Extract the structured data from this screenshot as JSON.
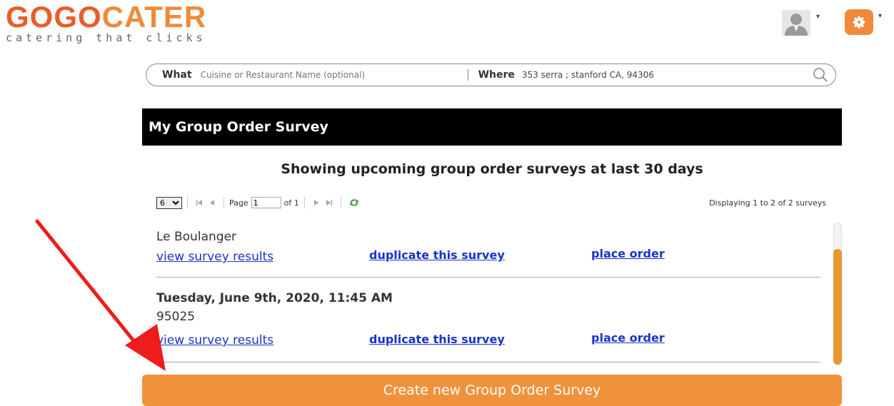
{
  "logo": {
    "part1": "GOGO",
    "part2": "CATER",
    "tagline": "catering that clicks"
  },
  "header": {
    "user_icon": "user-avatar-icon",
    "settings_icon": "gear-icon",
    "accent": "#f08a3a"
  },
  "search": {
    "what_label": "What",
    "what_placeholder": "Cuisine or Restaurant Name (optional)",
    "where_label": "Where",
    "where_value": "353 serra ; stanford CA, 94306"
  },
  "panel": {
    "title": "My Group Order Survey",
    "subtitle": "Showing upcoming group order surveys at last 30 days"
  },
  "pager": {
    "page_size": "6",
    "page_label": "Page",
    "page_value": "1",
    "of_label": "of 1",
    "displaying": "Displaying 1 to 2 of 2 surveys"
  },
  "surveys": [
    {
      "lines": [
        "Le Boulanger"
      ],
      "view_link": "view survey results",
      "duplicate_link": "duplicate this survey",
      "order_link": "place order"
    },
    {
      "date": "Tuesday, June 9th, 2020, 11:45 AM",
      "lines": [
        "95025"
      ],
      "view_link": "view survey results",
      "duplicate_link": "duplicate this survey",
      "order_link": "place order"
    }
  ],
  "create_button": "Create new Group Order Survey",
  "annotation": {
    "arrow_color": "#ee1c1c"
  }
}
